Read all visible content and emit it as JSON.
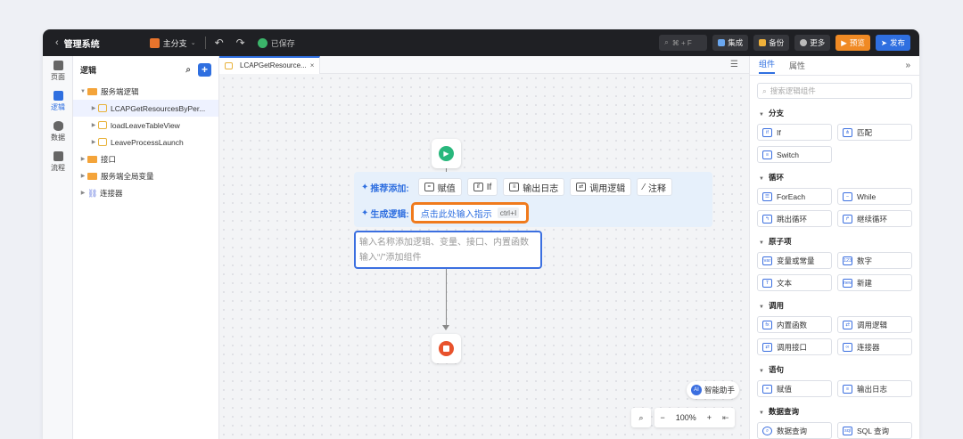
{
  "topbar": {
    "back": "‹",
    "title": "管理系统",
    "branch": "主分支",
    "saved": "已保存",
    "search_kbd": "⌘ + F",
    "buttons": {
      "integrate": "集成",
      "backup": "备份",
      "more": "更多",
      "preview": "预览",
      "publish": "发布"
    },
    "colors": {
      "preview": "#f08a24",
      "publish": "#2f6fe0"
    }
  },
  "rail": {
    "items": [
      {
        "label": "页面",
        "icon": "page-icon"
      },
      {
        "label": "逻辑",
        "icon": "logic-icon"
      },
      {
        "label": "数据",
        "icon": "data-icon"
      },
      {
        "label": "流程",
        "icon": "process-icon"
      }
    ],
    "active": "逻辑"
  },
  "tree": {
    "title": "逻辑",
    "nodes": [
      {
        "label": "服务端逻辑"
      },
      {
        "label": "LCAPGetResourcesByPer..."
      },
      {
        "label": "loadLeaveTableView"
      },
      {
        "label": "LeaveProcessLaunch"
      },
      {
        "label": "接口"
      },
      {
        "label": "服务端全局变量"
      },
      {
        "label": "连接器"
      }
    ]
  },
  "tab": {
    "label": "LCAPGetResource...",
    "close": "×"
  },
  "canvas": {
    "suggest_label": "推荐添加:",
    "chips": [
      {
        "label": "赋值",
        "icon": "assign-icon"
      },
      {
        "label": "If",
        "icon": "if-icon"
      },
      {
        "label": "输出日志",
        "icon": "log-icon"
      },
      {
        "label": "调用逻辑",
        "icon": "call-logic-icon"
      },
      {
        "label": "注释",
        "icon": "comment-icon"
      }
    ],
    "generate_label": "生成逻辑:",
    "ai_input": "点击此处输入指示",
    "ai_kbd": "ctrl+I",
    "node_placeholder_1": "输入名称添加逻辑、变量、接口、内置函数",
    "node_placeholder_2": "输入“/”添加组件",
    "assistant": "智能助手",
    "zoom": "100%",
    "zoom_minus": "−",
    "zoom_plus": "+"
  },
  "right": {
    "tabs": [
      "组件",
      "属性"
    ],
    "search_placeholder": "搜索逻辑组件",
    "sections": [
      {
        "title": "分支",
        "items": [
          "If",
          "匹配",
          "Switch"
        ]
      },
      {
        "title": "循环",
        "items": [
          "ForEach",
          "While",
          "跳出循环",
          "继续循环"
        ]
      },
      {
        "title": "原子项",
        "items": [
          "变量或常量",
          "数字",
          "文本",
          "新建"
        ]
      },
      {
        "title": "调用",
        "items": [
          "内置函数",
          "调用逻辑",
          "调用接口",
          "连接器"
        ]
      },
      {
        "title": "语句",
        "items": [
          "赋值",
          "输出日志"
        ]
      },
      {
        "title": "数据查询",
        "items": [
          "数据查询",
          "SQL 查询"
        ]
      }
    ]
  }
}
